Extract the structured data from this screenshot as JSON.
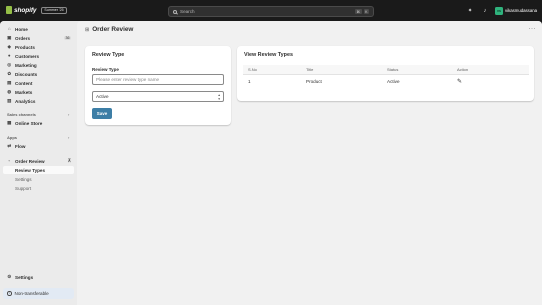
{
  "topbar": {
    "logo_text": "shopify",
    "plan_badge": "Summer '25",
    "search_placeholder": "Search",
    "shortcut_keys": [
      "⌘",
      "K"
    ],
    "store_initials": "vs",
    "store_name": "vikasmudassana"
  },
  "sidebar": {
    "items": [
      {
        "label": "Home",
        "icon": "home-icon"
      },
      {
        "label": "Orders",
        "icon": "orders-icon",
        "badge": "36"
      },
      {
        "label": "Products",
        "icon": "tag-icon"
      },
      {
        "label": "Customers",
        "icon": "person-icon"
      },
      {
        "label": "Marketing",
        "icon": "target-icon"
      },
      {
        "label": "Discounts",
        "icon": "discount-icon"
      },
      {
        "label": "Content",
        "icon": "content-icon"
      },
      {
        "label": "Markets",
        "icon": "globe-icon"
      },
      {
        "label": "Analytics",
        "icon": "analytics-icon"
      }
    ],
    "sales_channels_label": "Sales channels",
    "online_store_label": "Online Store",
    "apps_label": "Apps",
    "flow_label": "Flow",
    "app_name": "Order Review",
    "app_subitems": [
      "Review Types",
      "Settings",
      "Support"
    ],
    "settings_label": "Settings",
    "banner_label": "Non-transferable"
  },
  "page": {
    "title": "Order Review"
  },
  "form_card": {
    "title": "Review Type",
    "field_label": "Review Type",
    "input_placeholder": "Please enter review type name",
    "input_value": "",
    "status_selected": "Active",
    "save_label": "Save"
  },
  "list_card": {
    "title": "View Review Types",
    "columns": [
      "S.No",
      "Title",
      "Status",
      "Action"
    ],
    "rows": [
      {
        "sno": "1",
        "title": "Product",
        "status": "Active",
        "action_icon": "pencil-icon"
      }
    ]
  },
  "colors": {
    "topbar_bg": "#1a1a1a",
    "brand_green": "#95bf47",
    "save_button": "#3d7ea6",
    "banner_bg": "#e2eaf4"
  }
}
